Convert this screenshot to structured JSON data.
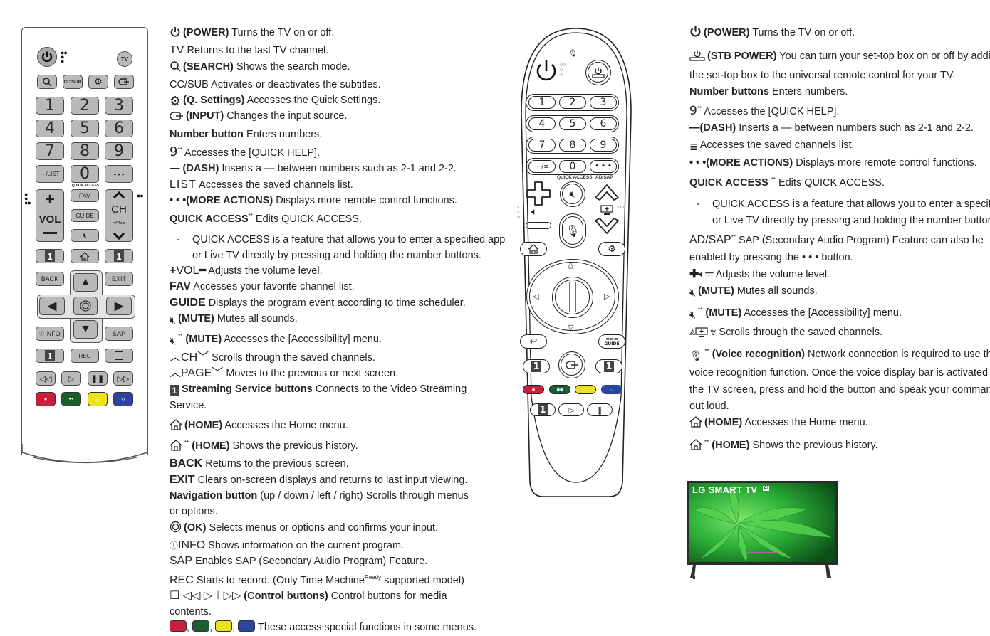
{
  "standard_remote": {
    "buttons": {
      "tv": "TV",
      "ccsub": "CC/SUB",
      "numbers": [
        "1",
        "2",
        "3",
        "4",
        "5",
        "6",
        "7",
        "8",
        "9"
      ],
      "list": "—/LIST",
      "zero": "0",
      "more": "• • •",
      "quick_access_label": "QUICK ACCESS",
      "vol": "VOL",
      "fav": "FAV",
      "guide": "GUIDE",
      "ch": "CH",
      "page": "PAGE",
      "stream": "1",
      "back": "BACK",
      "exit": "EXIT",
      "info": "INFO",
      "sap": "SAP",
      "rec": "REC"
    },
    "colors": {
      "red": "#c8203c",
      "green": "#1c5e2e",
      "yellow": "#ede21a",
      "blue": "#2a45a0",
      "button_gray": "#b9b9b9"
    }
  },
  "left_text": {
    "items": [
      {
        "key": "(POWER)",
        "desc": "Turns the TV on or off."
      },
      {
        "key": "TV",
        "desc": "Returns to the last TV channel."
      },
      {
        "key": "(SEARCH)",
        "desc": "Shows the search mode."
      },
      {
        "key": "CC/SUB",
        "desc": "Activates or deactivates the subtitles."
      },
      {
        "key": "(Q. Settings)",
        "desc": "Accesses the Quick Settings."
      },
      {
        "key": "(INPUT)",
        "desc": "Changes the input source."
      },
      {
        "key": "Number button",
        "desc": "Enters numbers."
      },
      {
        "key": "9",
        "desc": "Accesses the [QUICK HELP]."
      },
      {
        "key": "(DASH)",
        "desc": "Inserts a — between numbers such as 2-1 and 2-2."
      },
      {
        "key": "LIST",
        "desc": "Accesses the saved channels list."
      },
      {
        "key": "(MORE ACTIONS)",
        "desc": "Displays more remote control functions."
      },
      {
        "key": "QUICK ACCESS",
        "desc": "Edits QUICK ACCESS."
      },
      {
        "key": "-",
        "desc": "QUICK ACCESS is a feature that allows you to enter a specified app"
      },
      {
        "key": "",
        "desc": "or Live TV directly by pressing and holding the number buttons."
      },
      {
        "key": "VOL",
        "desc": "Adjusts the volume level."
      },
      {
        "key": "FAV",
        "desc": "Accesses your favorite channel list."
      },
      {
        "key": "GUIDE",
        "desc": "Displays the program event according to time scheduler."
      },
      {
        "key": "(MUTE)",
        "desc": "Mutes all sounds."
      },
      {
        "key": "(MUTE)",
        "desc": "Accesses the [Accessibility] menu."
      },
      {
        "key": "CH",
        "desc": "Scrolls through the saved channels."
      },
      {
        "key": "PAGE",
        "desc": "Moves to the previous or next screen."
      },
      {
        "key": "Streaming Service buttons",
        "desc": "Connects to the Video Streaming"
      },
      {
        "key": "",
        "desc": "Service."
      },
      {
        "key": "(HOME)",
        "desc": "Accesses the Home menu."
      },
      {
        "key": "(HOME)",
        "desc": "Shows the previous history."
      },
      {
        "key": "BACK",
        "desc": "Returns to the previous screen."
      },
      {
        "key": "EXIT",
        "desc": "Clears on-screen displays and returns to last input viewing."
      },
      {
        "key": "Navigation button",
        "desc": "(up / down / left / right)  Scrolls through menus"
      },
      {
        "key": "",
        "desc": "or options."
      },
      {
        "key": "(OK)",
        "desc": "Selects menus or options and confirms your input."
      },
      {
        "key": "INFO",
        "desc": "Shows information on the current program."
      },
      {
        "key": "SAP",
        "desc": "Enables SAP (Secondary Audio Program) Feature."
      },
      {
        "key": "REC",
        "desc": "Starts to record. (Only Time Machine",
        "sup": "Ready",
        "desc2": "supported model)"
      },
      {
        "key": "(Control buttons)",
        "desc": "Control buttons for media"
      },
      {
        "key": "",
        "desc": "contents."
      },
      {
        "key": "",
        "desc": "These access special functions in some menus."
      }
    ],
    "stream_key": "1",
    "nine_key": "9",
    "sup_marker": "**"
  },
  "magic_remote": {
    "numbers": [
      "1",
      "2",
      "3",
      "4",
      "5",
      "6",
      "7",
      "8",
      "9"
    ],
    "zero": "0",
    "more": "• • •",
    "quick_access_label": "QUICK ACCESS",
    "adsap_label": "AD/SAP",
    "list_label": "LIST",
    "guide_label": "GUIDE",
    "stream": "1"
  },
  "right_text": {
    "items": [
      {
        "key": "(POWER)",
        "desc": "Turns the TV on or off."
      },
      {
        "key": "(STB POWER)",
        "desc": "You can turn your set-top box on or off by adding"
      },
      {
        "key": "",
        "desc": "the set-top box to the universal remote control for your TV."
      },
      {
        "key": "Number buttons",
        "desc": "Enters numbers."
      },
      {
        "key": "9",
        "desc": "Accesses the [QUICK HELP]."
      },
      {
        "key": "(DASH)",
        "desc": "Inserts a — between numbers such as 2-1 and 2-2."
      },
      {
        "key": "LIST",
        "desc": "Accesses the saved channels list."
      },
      {
        "key": "(MORE ACTIONS)",
        "desc": "Displays more remote control functions."
      },
      {
        "key": "QUICK ACCESS",
        "desc": "Edits QUICK ACCESS."
      },
      {
        "key": "-",
        "desc": "QUICK ACCESS is a feature that allows you to enter a specified app"
      },
      {
        "key": "",
        "desc": "or Live TV directly by pressing and holding the number buttons."
      },
      {
        "key": "AD/SAP",
        "desc": "SAP (Secondary Audio Program) Feature can also be"
      },
      {
        "key": "",
        "desc": "enabled by pressing the • • • button."
      },
      {
        "key": "",
        "desc": "Adjusts the volume level."
      },
      {
        "key": "(MUTE)",
        "desc": "Mutes all sounds."
      },
      {
        "key": "(MUTE)",
        "desc": "Accesses the [Accessibility] menu."
      },
      {
        "key": "",
        "desc": "Scrolls through the saved channels."
      },
      {
        "key": "(Voice recognition)",
        "desc": "Network connection is required to use the"
      },
      {
        "key": "",
        "desc": "voice recognition function. Once the voice display bar is activated on"
      },
      {
        "key": "",
        "desc": "the TV screen, press and hold the button and speak your command"
      },
      {
        "key": "",
        "desc": "out loud."
      },
      {
        "key": "(HOME)",
        "desc": "Accesses the Home menu."
      },
      {
        "key": "(HOME)",
        "desc": "Shows the previous history."
      }
    ],
    "nine_key": "9",
    "sup_marker": "**"
  },
  "tv_image": {
    "brand_text": "LG SMART TV",
    "badge": "AI",
    "screen_color": "#2fb33a"
  }
}
